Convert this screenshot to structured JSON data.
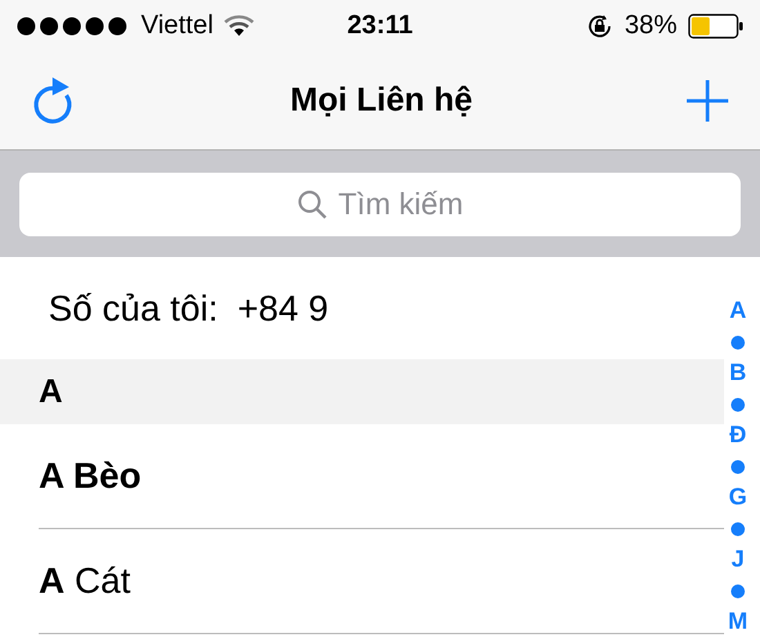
{
  "status_bar": {
    "carrier": "Viettel",
    "time": "23:11",
    "battery": "38%"
  },
  "nav_bar": {
    "title": "Mọi Liên hệ"
  },
  "search": {
    "placeholder": "Tìm kiếm"
  },
  "my_number": {
    "label": "Số của tôi:",
    "value": "+84 9"
  },
  "sections": [
    {
      "header": "A",
      "contacts": [
        {
          "name": "A Bèo",
          "bold": true
        },
        {
          "name": "**A** Cát",
          "bold": false
        }
      ]
    }
  ],
  "index": [
    {
      "kind": "letter",
      "text": "A"
    },
    {
      "kind": "dot"
    },
    {
      "kind": "letter",
      "text": "B"
    },
    {
      "kind": "dot"
    },
    {
      "kind": "letter",
      "text": "Đ"
    },
    {
      "kind": "dot"
    },
    {
      "kind": "letter",
      "text": "G"
    },
    {
      "kind": "dot"
    },
    {
      "kind": "letter",
      "text": "J"
    },
    {
      "kind": "dot"
    },
    {
      "kind": "letter",
      "text": "M"
    }
  ]
}
